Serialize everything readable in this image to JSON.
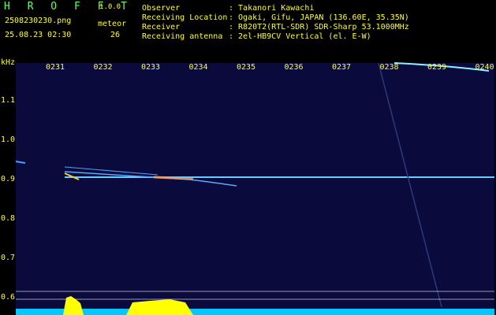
{
  "app": {
    "name": "H R O F F T",
    "version": "1.0.0"
  },
  "file": {
    "name": "2508230230.png",
    "datetime": "25.08.23 02:30"
  },
  "meteor": {
    "label": "meteor",
    "count": "26"
  },
  "info": {
    "observer_label": "Observer",
    "observer_value": ": Takanori Kawachi",
    "location_label": "Receiving Location",
    "location_value": ": Ogaki, Gifu, JAPAN (136.60E, 35.35N)",
    "receiver_label": "Receiver",
    "receiver_value": ": R820T2(RTL-SDR) SDR-Sharp 53.1000MHz",
    "antenna_label": "Receiving antenna",
    "antenna_value": ": 2el-HB9CV Vertical (el. E-W)"
  },
  "axis": {
    "unit": "kHz",
    "time_ticks": [
      "0231",
      "0232",
      "0233",
      "0234",
      "0235",
      "0236",
      "0237",
      "0238",
      "0239",
      "0240"
    ],
    "freq_ticks": [
      "1.1",
      "1.0",
      "0.9",
      "0.8",
      "0.7",
      "0.6"
    ]
  },
  "colors": {
    "background": "#0a0a3c",
    "signal": "#66ccff",
    "level": "#ffff00",
    "meter": "#00c8ff"
  }
}
